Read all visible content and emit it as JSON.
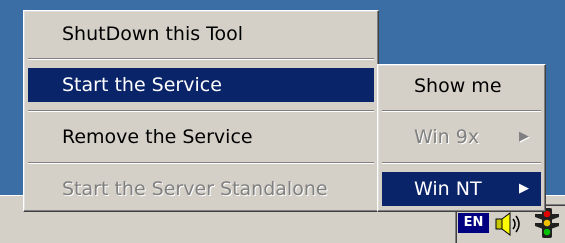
{
  "main_menu": {
    "items": [
      {
        "label": "ShutDown this Tool"
      },
      {
        "label": "Start the Service"
      },
      {
        "label": "Remove the Service"
      },
      {
        "label": "Start the Server Standalone"
      }
    ]
  },
  "sub_menu": {
    "items": [
      {
        "label": "Show me"
      },
      {
        "label": "Win 9x",
        "arrow": "▶"
      },
      {
        "label": "Win NT",
        "arrow": "▶"
      }
    ]
  },
  "tray": {
    "language": "EN",
    "icons": [
      "speaker-icon",
      "traffic-light-icon"
    ]
  },
  "colors": {
    "desktop": "#3a6ea5",
    "menu_bg": "#d4d0c8",
    "selection": "#0a246a",
    "disabled_text": "#808080"
  }
}
